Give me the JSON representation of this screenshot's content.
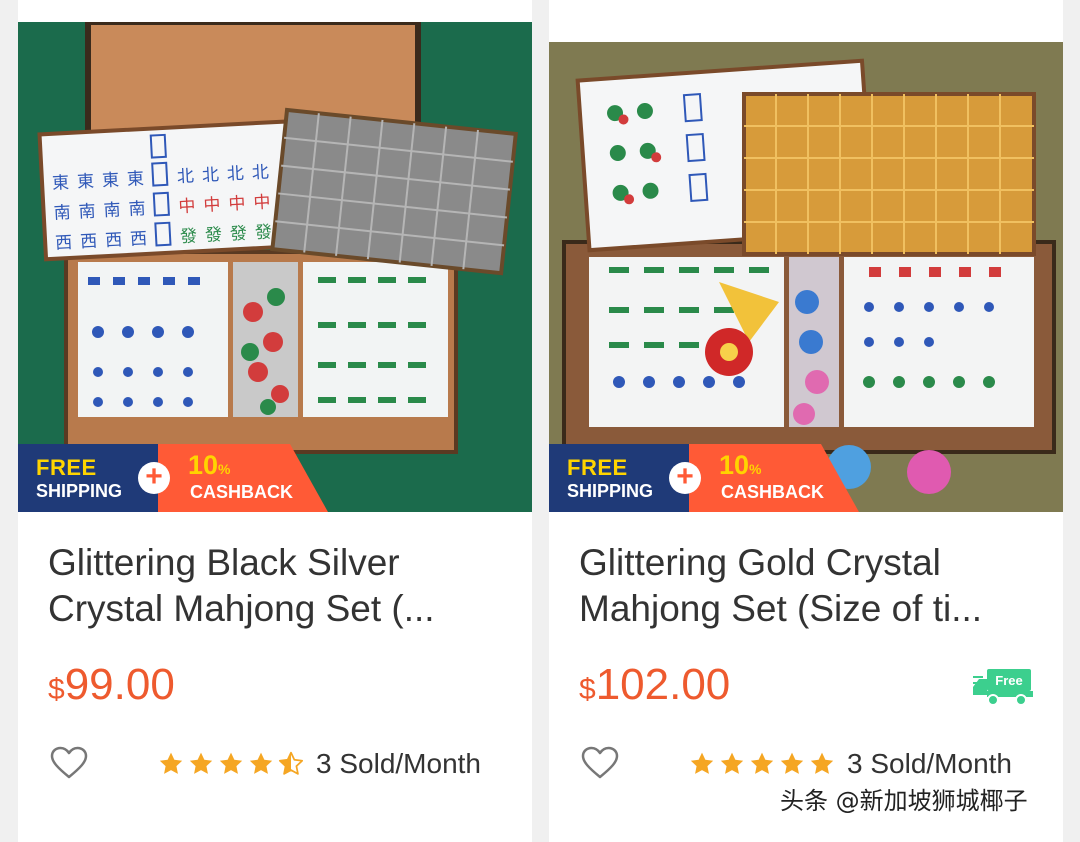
{
  "products": [
    {
      "title": "Glittering Black Silver Crystal Mahjong Set (...",
      "currency": "$",
      "price": "99.00",
      "promo": {
        "free": "FREE",
        "shipping": "SHIPPING",
        "plus": "+",
        "percent": "10",
        "percent_sign": "%",
        "cashback": "CASHBACK"
      },
      "rating": 4.5,
      "sold": "3 Sold/Month",
      "free_shipping_badge": false
    },
    {
      "title": "Glittering Gold Crystal Mahjong Set (Size of ti...",
      "currency": "$",
      "price": "102.00",
      "promo": {
        "free": "FREE",
        "shipping": "SHIPPING",
        "plus": "+",
        "percent": "10",
        "percent_sign": "%",
        "cashback": "CASHBACK"
      },
      "rating": 5,
      "sold": "3 Sold/Month",
      "free_shipping_badge": true,
      "truck_label": "Free"
    }
  ],
  "watermark": "头条 @新加坡狮城椰子",
  "colors": {
    "price": "#ee5a2e",
    "star": "#f5a623",
    "promo_navy": "#1f3a78",
    "promo_orange": "#ff5a36",
    "truck": "#3ccf8e"
  },
  "icons": [
    "heart-icon",
    "star-icon",
    "half-star-icon",
    "plus-icon",
    "free-shipping-truck-icon"
  ]
}
